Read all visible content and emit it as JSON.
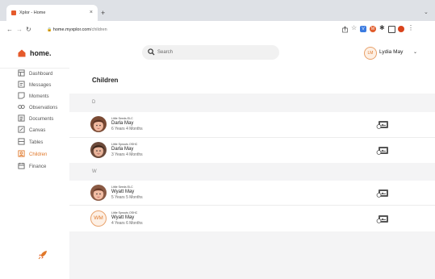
{
  "browser": {
    "tab_title": "Xplor - Home",
    "tab_close": "×",
    "new_tab": "+",
    "tab_chevron": "⌄",
    "url_host": "home.myxplor.com",
    "url_path": "/children",
    "ext_v_label": "V",
    "ext_m_label": "M"
  },
  "app": {
    "logo_text": "home.",
    "search_placeholder": "Search",
    "user": {
      "initials": "LM",
      "name": "Lydia May"
    }
  },
  "sidebar": {
    "items": [
      {
        "label": "Dashboard",
        "icon": "dashboard-icon"
      },
      {
        "label": "Messages",
        "icon": "messages-icon"
      },
      {
        "label": "Moments",
        "icon": "moments-icon"
      },
      {
        "label": "Observations",
        "icon": "observations-icon"
      },
      {
        "label": "Documents",
        "icon": "documents-icon"
      },
      {
        "label": "Canvas",
        "icon": "canvas-icon"
      },
      {
        "label": "Tables",
        "icon": "tables-icon"
      },
      {
        "label": "Children",
        "icon": "children-icon",
        "active": true
      },
      {
        "label": "Finance",
        "icon": "finance-icon"
      }
    ]
  },
  "main": {
    "title": "Children",
    "groups": [
      {
        "letter": "D",
        "children": [
          {
            "school": "Little Seeds ELC",
            "name": "Darla May",
            "age": "6 Years 4 Months",
            "avatar": "photo"
          },
          {
            "school": "Little Sprouts OSHC",
            "name": "Darla May",
            "age": "3 Years 4 Months",
            "avatar": "photo"
          }
        ]
      },
      {
        "letter": "W",
        "children": [
          {
            "school": "Little Seeds ELC",
            "name": "Wyatt May",
            "age": "5 Years 5 Months",
            "avatar": "photo"
          },
          {
            "school": "Little Sprouts OSHC",
            "name": "Wyatt May",
            "age": "4 Years 6 Months",
            "avatar": "initials",
            "initials": "WM"
          }
        ]
      }
    ]
  },
  "colors": {
    "accent": "#e0782a",
    "brand": "#e55a2b"
  }
}
